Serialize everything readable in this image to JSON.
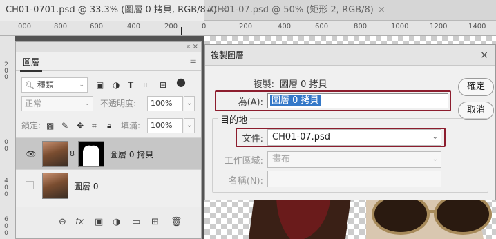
{
  "tabs": [
    {
      "label": "CH01-0701.psd @ 33.3% (圖層 0 拷貝, RGB/8#)",
      "close": "×"
    },
    {
      "label": "CH01-07.psd @ 50% (矩形 2, RGB/8)",
      "close": "×"
    }
  ],
  "ruler_left": [
    "000",
    "800",
    "600",
    "400",
    "200"
  ],
  "ruler_right": [
    "0",
    "200",
    "400",
    "600",
    "800",
    "1000",
    "1200",
    "1400"
  ],
  "vruler": [
    "200",
    "0",
    "2",
    "0",
    "0",
    "4",
    "0",
    "0",
    "6",
    "0",
    "0"
  ],
  "layers_panel": {
    "collapse": "«  ×",
    "tab_label": "圖層",
    "menu_icon": "≡",
    "filter_placeholder": "種類",
    "blend_mode": "正常",
    "opacity_label": "不透明度:",
    "opacity_value": "100%",
    "lock_label": "鎖定:",
    "fill_label": "填滿:",
    "fill_value": "100%",
    "layers": [
      {
        "name": "圖層 0 拷貝",
        "active": true,
        "visible": true
      },
      {
        "name": "圖層 0",
        "active": false,
        "visible": false
      }
    ],
    "footer_icons": [
      "link-icon",
      "fx-icon",
      "mask-icon",
      "adjustment-icon",
      "folder-icon",
      "new-layer-icon",
      "trash-icon"
    ]
  },
  "dialog": {
    "title": "複製圖層",
    "close": "×",
    "duplicate_label": "複製:",
    "duplicate_value": "圖層 0 拷貝",
    "as_label": "為(A):",
    "as_value": "圖層 0 拷貝",
    "ok_button": "確定",
    "cancel_button": "取消",
    "destination_title": "目的地",
    "document_label": "文件:",
    "document_value": "CH01-07.psd",
    "artboard_label": "工作區域:",
    "artboard_value": "畫布",
    "name_label": "名稱(N):",
    "name_value": ""
  }
}
